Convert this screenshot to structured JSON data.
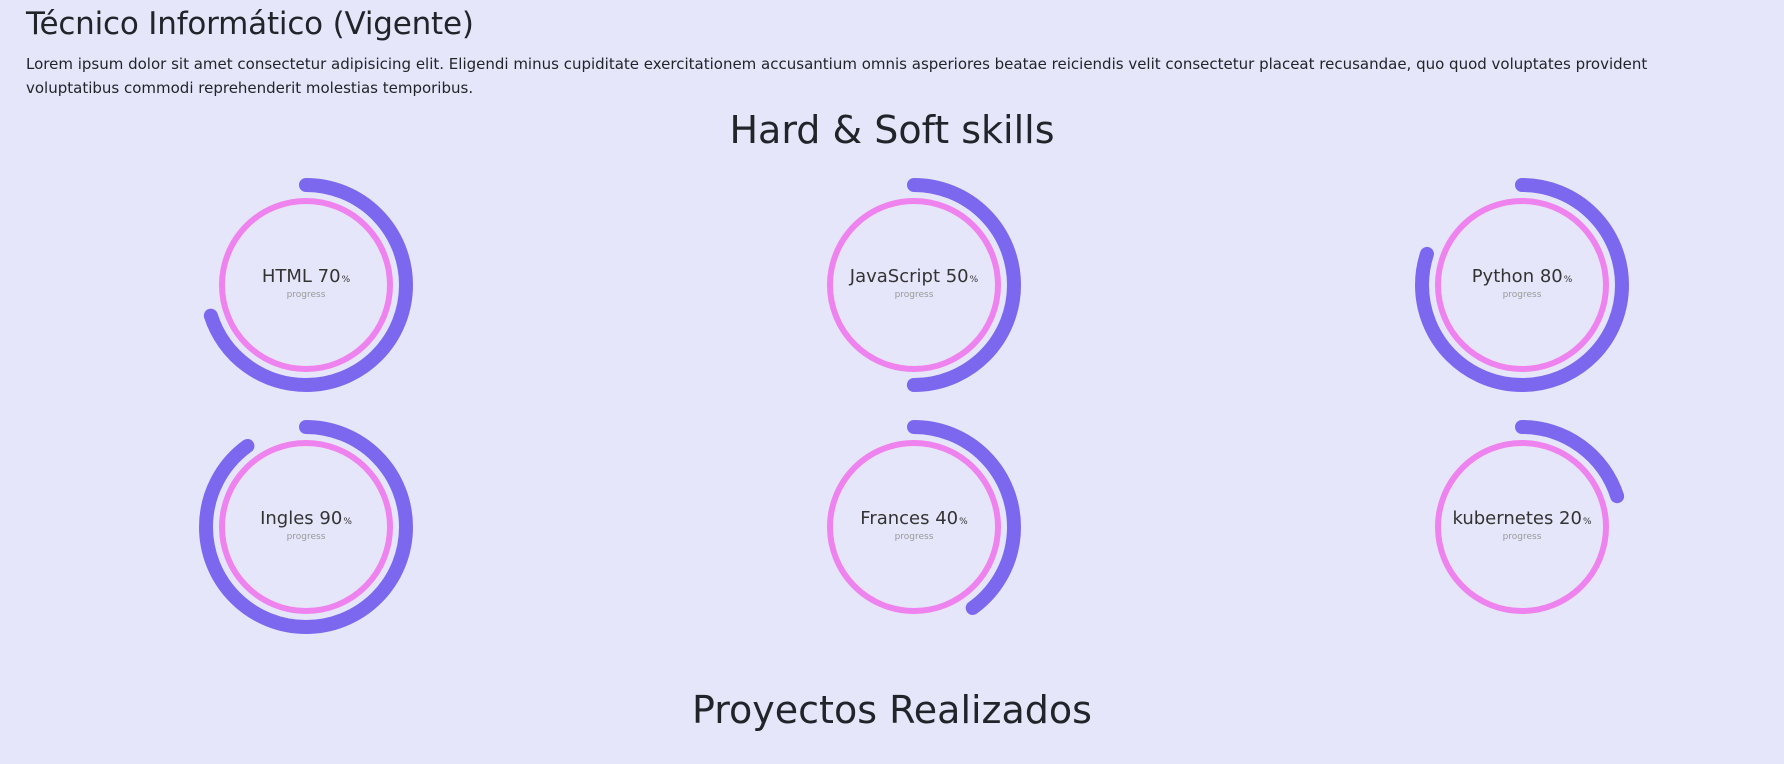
{
  "education": {
    "title": "Técnico Informático (Vigente)",
    "description": "Lorem ipsum dolor sit amet consectetur adipisicing elit. Eligendi minus cupiditate exercitationem accusantium omnis asperiores beatae reiciendis velit consectetur placeat recusandae, quo quod voluptates provident voluptatibus commodi reprehenderit molestias temporibus."
  },
  "skills_section": {
    "title": "Hard & Soft skills",
    "sub_label": "progress",
    "percent_sign": "%",
    "colors": {
      "progress": "#7b68ee",
      "ring": "#ee82ee"
    },
    "items": [
      {
        "name": "HTML",
        "value": 70
      },
      {
        "name": "JavaScript",
        "value": 50
      },
      {
        "name": "Python",
        "value": 80
      },
      {
        "name": "Ingles",
        "value": 90
      },
      {
        "name": "Frances",
        "value": 40
      },
      {
        "name": "kubernetes",
        "value": 20
      }
    ]
  },
  "projects_section": {
    "title": "Proyectos Realizados"
  }
}
